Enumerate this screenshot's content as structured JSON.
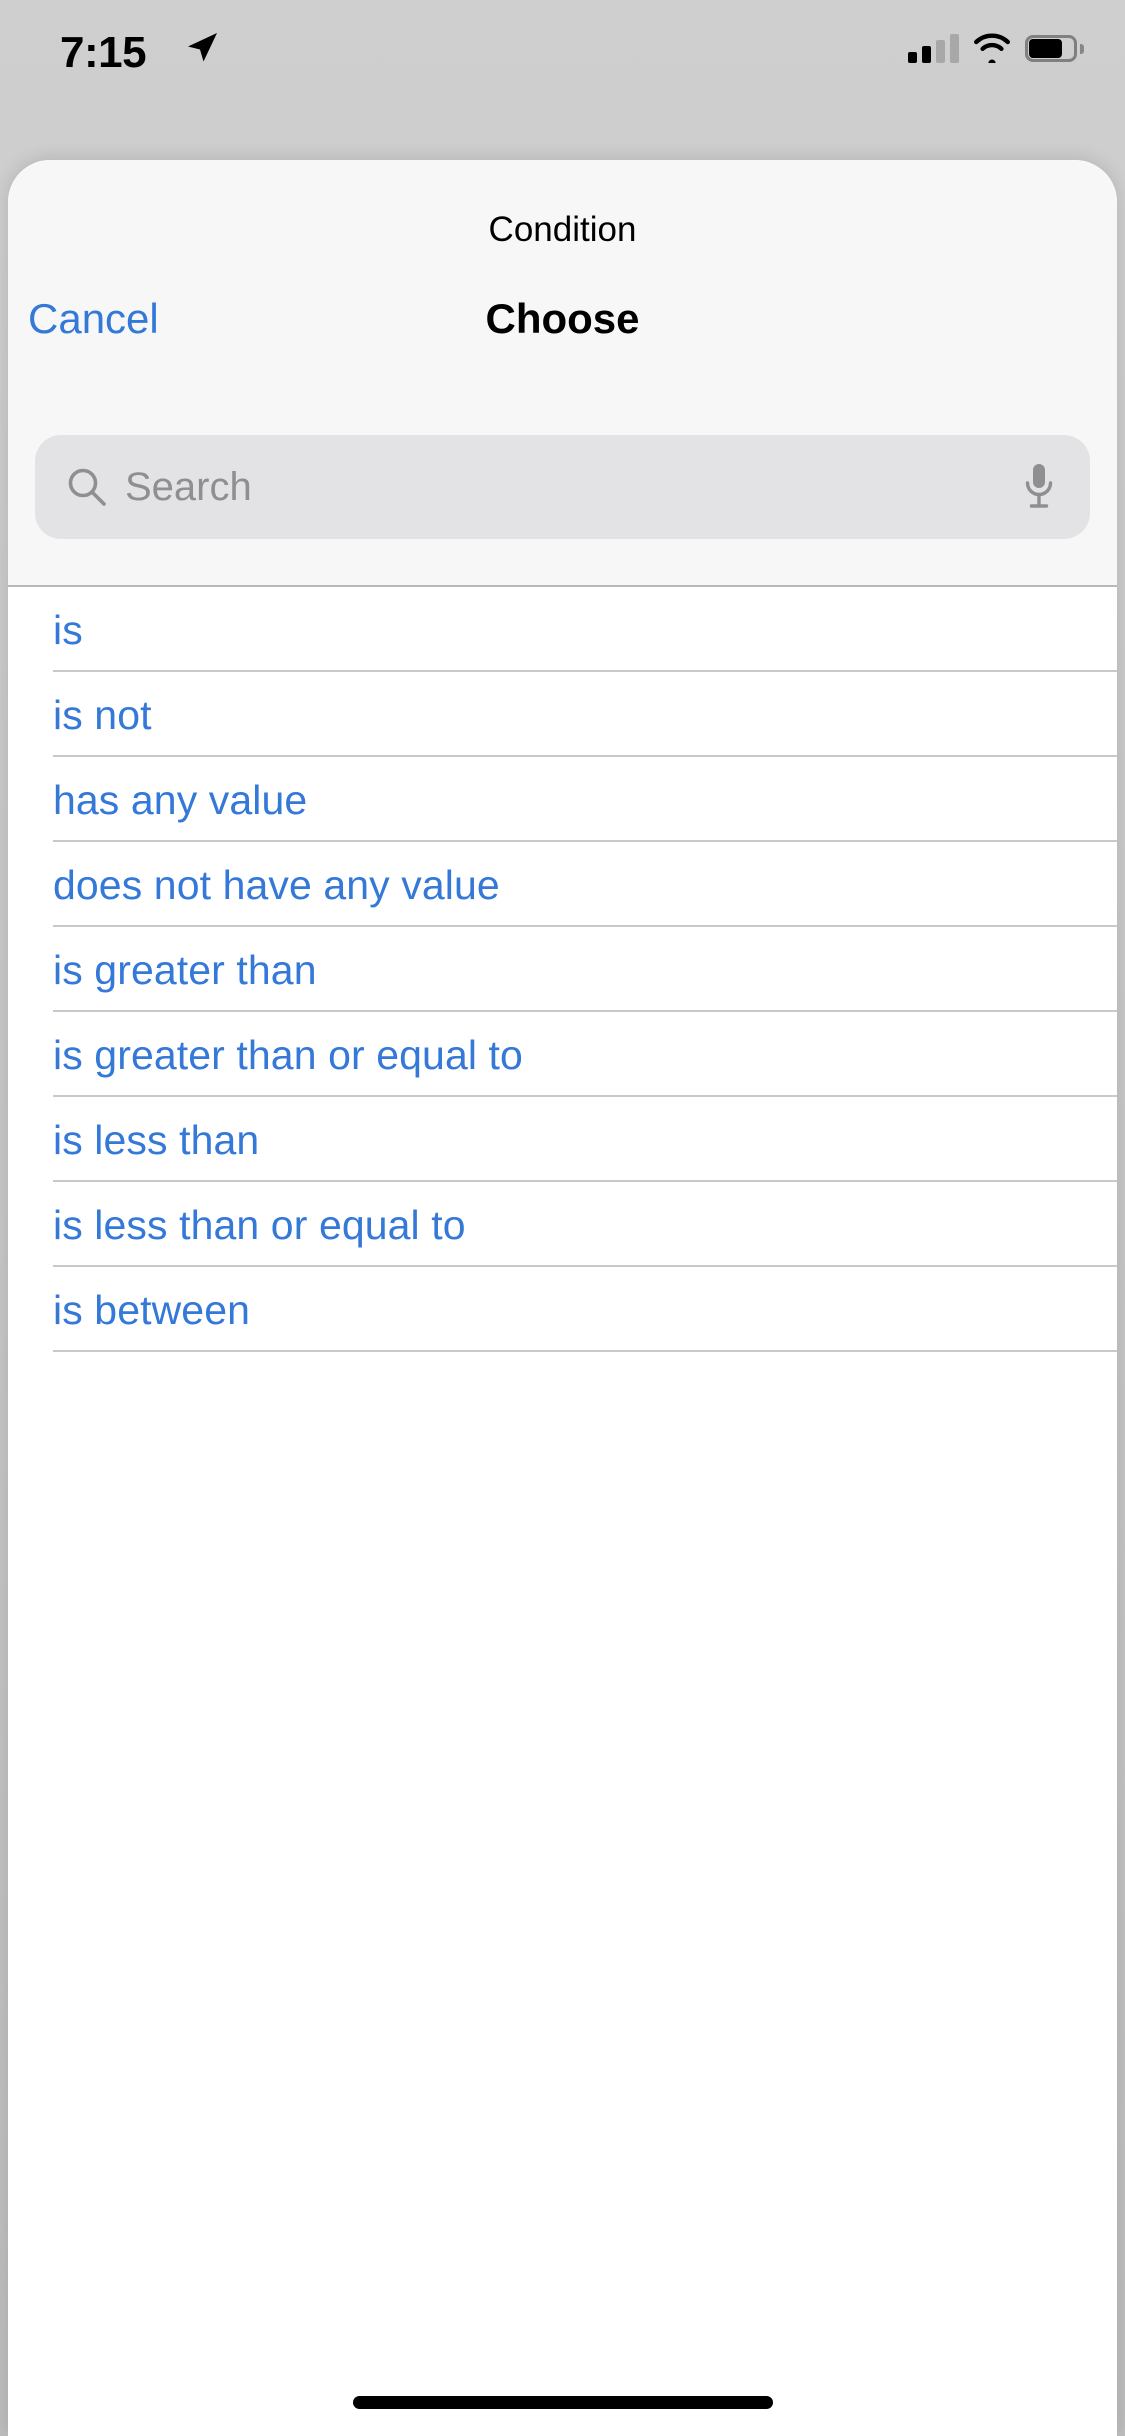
{
  "status_bar": {
    "time": "7:15",
    "location_icon": "location-arrow-icon",
    "cellular_icon": "cellular-signal-icon",
    "cellular_bars_filled": 2,
    "cellular_bars_total": 4,
    "wifi_icon": "wifi-icon",
    "battery_icon": "battery-icon",
    "battery_level_percent": 75
  },
  "sheet": {
    "title": "Condition",
    "nav": {
      "cancel_label": "Cancel",
      "heading": "Choose"
    },
    "search": {
      "placeholder": "Search",
      "value": "",
      "search_icon": "magnifying-glass-icon",
      "mic_icon": "microphone-icon"
    }
  },
  "options": [
    {
      "label": "is"
    },
    {
      "label": "is not"
    },
    {
      "label": "has any value"
    },
    {
      "label": "does not have any value"
    },
    {
      "label": "is greater than"
    },
    {
      "label": "is greater than or equal to"
    },
    {
      "label": "is less than"
    },
    {
      "label": "is less than or equal to"
    },
    {
      "label": "is between"
    }
  ],
  "colors": {
    "accent_blue": "#3478d8",
    "header_bg": "#f7f7f7",
    "separator": "#c9c9cb",
    "search_bg": "#e3e3e5",
    "placeholder_gray": "#8e8e93"
  },
  "home_indicator": "home-indicator"
}
